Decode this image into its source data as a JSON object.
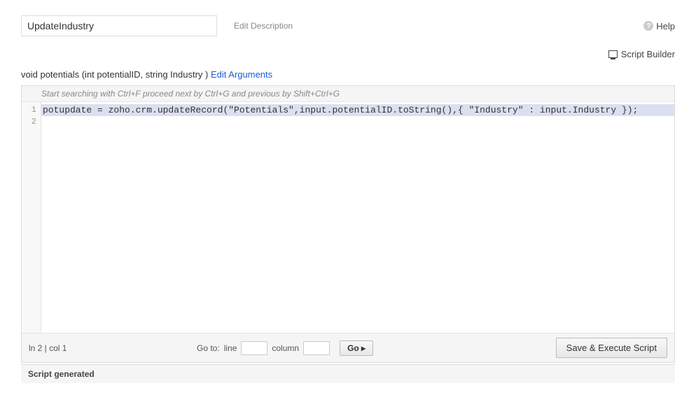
{
  "header": {
    "function_name": "UpdateIndustry",
    "edit_description": "Edit Description",
    "help_label": "Help"
  },
  "toolbar": {
    "script_builder": "Script Builder"
  },
  "signature": {
    "text": "void potentials (int potentialID,  string Industry )",
    "edit_arguments": "Edit Arguments"
  },
  "editor": {
    "search_hint": "Start searching with Ctrl+F proceed next by Ctrl+G and previous by Shift+Ctrl+G",
    "lines": [
      "potupdate = zoho.crm.updateRecord(\"Potentials\",input.potentialID.toString(),{ \"Industry\" : input.Industry });",
      ""
    ],
    "line_numbers": [
      "1",
      "2"
    ]
  },
  "status": {
    "cursor": "ln 2 | col 1",
    "goto_label": "Go to:",
    "line_label": "line",
    "column_label": "column",
    "go_button": "Go ▸",
    "save_button": "Save & Execute Script"
  },
  "footer": {
    "script_generated": "Script generated"
  }
}
